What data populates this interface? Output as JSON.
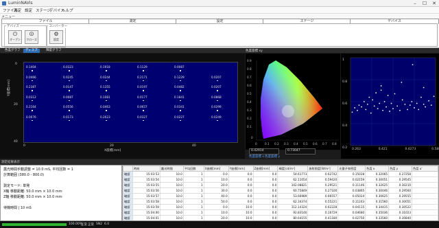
{
  "window": {
    "title": "LuminNAVIs",
    "minimize": "–",
    "maximize": "☐",
    "close": "✕"
  },
  "menu": [
    "ファイル",
    "測定",
    "設定",
    "ステージ",
    "デバイス",
    "ヘルプ"
  ],
  "ribbon": {
    "label": "メニュー",
    "tabs": [
      "ファイル",
      "測定",
      "設定",
      "ステージ",
      "デバイス"
    ],
    "active_tab": 4,
    "groups": [
      {
        "caption": "デバイス",
        "buttons": [
          {
            "label": "オープン",
            "icon": "plug-icon"
          },
          {
            "label": "クローズ",
            "icon": "unplug-icon"
          }
        ]
      },
      {
        "caption": "コンバーター",
        "buttons": [
          {
            "label": "設定",
            "icon": "gear-icon"
          }
        ]
      }
    ]
  },
  "panel_tabs": {
    "tabs": [
      "色差グラフ",
      "ディスプ",
      "輝度グラフ"
    ],
    "active": 1
  },
  "cie_title": "色度座標 xy",
  "heatmap": {
    "ytick_labels": [
      "0",
      "20",
      "40"
    ],
    "xtick_labels": [
      "0",
      "20",
      "40"
    ],
    "ylabel": "Y座標[mm]",
    "xlabel": "X座標[mm]",
    "rows": [
      [
        "0.1404",
        "0.0323",
        "0.1918",
        "0.1129",
        "0.0087"
      ],
      [
        "0.0466",
        "0.0245",
        "0.0244",
        "0.2171",
        "0.1229",
        "0.0207"
      ],
      [
        "0.2387",
        "0.0147",
        "0.1355",
        "0.0197",
        "0.0482",
        "0.0207"
      ],
      [
        "0.0312",
        "0.0087",
        "0.1081",
        "0.0177",
        "0.1841",
        "0.0868"
      ],
      [
        "0.2164",
        "0.0556",
        "0.0463",
        "0.0657",
        "0.0341",
        "0.0299"
      ],
      [
        "0.0076",
        "0.0173",
        "0.2023",
        "0.0327",
        "0.0227",
        "0.0249"
      ]
    ]
  },
  "cie_chart": {
    "yticks": [
      "0.9",
      "0.8",
      "0.7",
      "0.6",
      "0.5",
      "0.4",
      "0.3",
      "0.2",
      "0.1",
      "0"
    ],
    "xticks": [
      "0",
      "0.1",
      "0.2",
      "0.3",
      "0.4",
      "0.5",
      "0.6",
      "0.7",
      "0.8"
    ],
    "fields": [
      "0.42914",
      "0.73047"
    ],
    "link_x": "色度座標 x",
    "link_y": "色度座標 y"
  },
  "chart_data": {
    "type": "scatter",
    "title": "",
    "xlabel": "",
    "ylabel": "",
    "xticks": [
      "0.263",
      "0.421",
      "0.4273",
      "0.5882"
    ],
    "yticks": [
      "1",
      "0.8",
      "0.6",
      "0.4",
      "0.2"
    ],
    "ylim": [
      0.2,
      1.05
    ],
    "grid": true,
    "points_norm": [
      [
        0.02,
        0.38
      ],
      [
        0.05,
        0.43
      ],
      [
        0.08,
        0.4
      ],
      [
        0.1,
        0.46
      ],
      [
        0.13,
        0.44
      ],
      [
        0.16,
        0.5
      ],
      [
        0.18,
        0.41
      ],
      [
        0.2,
        0.47
      ],
      [
        0.22,
        0.55
      ],
      [
        0.24,
        0.37
      ],
      [
        0.26,
        0.52
      ],
      [
        0.28,
        0.45
      ],
      [
        0.3,
        0.6
      ],
      [
        0.32,
        0.42
      ],
      [
        0.34,
        0.48
      ],
      [
        0.36,
        0.63
      ],
      [
        0.38,
        0.4
      ],
      [
        0.4,
        0.5
      ],
      [
        0.42,
        0.44
      ],
      [
        0.44,
        0.57
      ],
      [
        0.46,
        0.39
      ],
      [
        0.48,
        0.48
      ],
      [
        0.5,
        0.42
      ],
      [
        0.52,
        0.59
      ],
      [
        0.55,
        0.45
      ],
      [
        0.58,
        0.4
      ],
      [
        0.61,
        0.52
      ],
      [
        0.64,
        0.47
      ],
      [
        0.67,
        0.41
      ],
      [
        0.7,
        0.46
      ],
      [
        0.72,
        0.5
      ],
      [
        0.75,
        0.43
      ],
      [
        0.78,
        0.48
      ],
      [
        0.8,
        0.41
      ],
      [
        0.83,
        0.55
      ],
      [
        0.86,
        0.47
      ],
      [
        0.88,
        0.44
      ],
      [
        0.92,
        0.51
      ],
      [
        0.95,
        0.46
      ],
      [
        0.98,
        0.56
      ],
      [
        0.73,
        0.92
      ],
      [
        0.36,
        0.68
      ],
      [
        0.86,
        0.66
      ],
      [
        0.6,
        0.72
      ]
    ]
  },
  "bottom_caption": "測定結果表示",
  "info_lines": [
    "露光時間手動調整 = 10.0 mS, 平均回数 = 1",
    "計算範囲 (380.0 - 800.0)",
    "",
    "測定モード: 単発",
    "X軸 移動距離: 50.0 mm × 10.0 mm",
    "Z軸 移動距離: 50.0 mm × 10.0 mm",
    "",
    "待機時間 | 10 mS"
  ],
  "table": {
    "columns": [
      "",
      "時刻",
      "露光時間",
      "平均回数",
      "X座標[mm]",
      "Y座標[mm]",
      "Z座標[mm]",
      "輝度[cd/m²]",
      "放射照度[W/m²]",
      "光量子束密度",
      "色度 x",
      "色度 y",
      "色度 u'"
    ],
    "rows": [
      [
        "確認",
        "15:03:53",
        "10.0",
        "1",
        "0.0",
        "0.0",
        "0.0",
        "54.61773",
        "0.62742",
        "0.15028",
        "0.32065",
        "0.27258"
      ],
      [
        "確認",
        "15:03:54",
        "10.0",
        "1",
        "10.0",
        "0.0",
        "0.0",
        "62.11054",
        "0.59420",
        "0.02159",
        "0.30051",
        "0.29545"
      ],
      [
        "確認",
        "15:03:55",
        "10.0",
        "1",
        "20.0",
        "0.0",
        "0.0",
        "102.08821",
        "0.29521",
        "0.11146",
        "0.32625",
        "0.30210"
      ],
      [
        "確認",
        "15:03:56",
        "10.0",
        "1",
        "30.0",
        "0.0",
        "0.0",
        "60.75849",
        "0.27100",
        "0.03865",
        "0.30046",
        "0.29560"
      ],
      [
        "確認",
        "15:03:57",
        "10.0",
        "1",
        "40.0",
        "0.0",
        "0.0",
        "53.66989",
        "0.66557",
        "0.05024",
        "0.30625",
        "0.29555"
      ],
      [
        "確認",
        "15:03:58",
        "10.0",
        "1",
        "50.0",
        "0.0",
        "0.0",
        "62.34374",
        "0.55221",
        "0.11243",
        "0.31560",
        "0.30051"
      ],
      [
        "確認",
        "15:03:59",
        "10.0",
        "1",
        "0.0",
        "10.0",
        "0.0",
        "112.14324",
        "0.62228",
        "0.04115",
        "0.34415",
        "0.30522"
      ],
      [
        "確認",
        "15:04:00",
        "10.0",
        "1",
        "10.0",
        "10.0",
        "0.0",
        "92.83146",
        "0.16729",
        "0.04680",
        "0.35036",
        "0.31023"
      ],
      [
        "確認",
        "15:04:01",
        "10.0",
        "1",
        "20.0",
        "10.0",
        "0.0",
        "80.64155",
        "0.41180",
        "0.02750",
        "0.33560",
        "0.30840"
      ]
    ]
  },
  "status": {
    "progress_percent": 100,
    "text1": "100.00%",
    "text2": "正常",
    "text3": "正常",
    "text4": "SN2",
    "text5": "6.0"
  }
}
